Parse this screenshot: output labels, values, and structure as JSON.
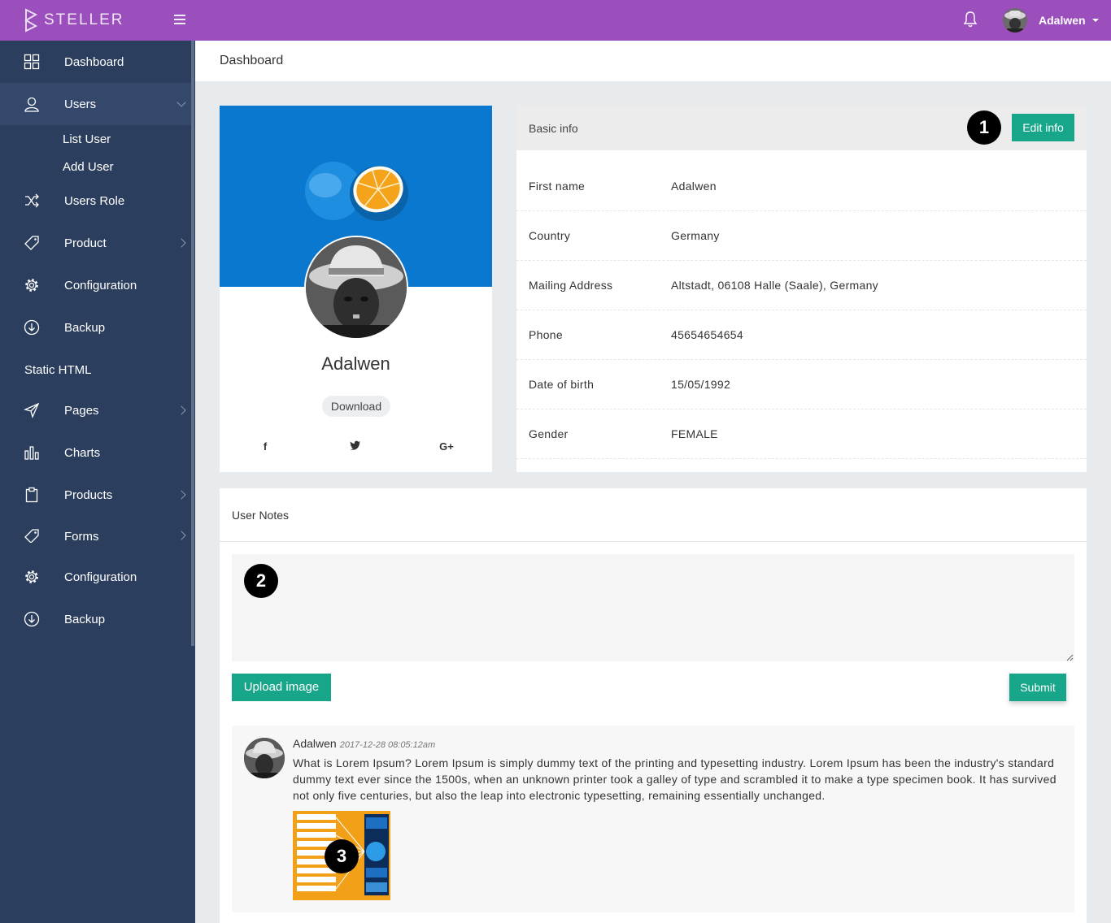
{
  "app": {
    "brand": "STELLER"
  },
  "topbar": {
    "username": "Adalwen"
  },
  "sidebar": {
    "items": [
      {
        "label": "Dashboard"
      },
      {
        "label": "Users"
      },
      {
        "label": "Users Role"
      },
      {
        "label": "Product"
      },
      {
        "label": "Configuration"
      },
      {
        "label": "Backup"
      },
      {
        "label": "Pages"
      },
      {
        "label": "Charts"
      },
      {
        "label": "Products"
      },
      {
        "label": "Forms"
      },
      {
        "label": "Configuration"
      },
      {
        "label": "Backup"
      }
    ],
    "users_sub": [
      "List User",
      "Add User"
    ],
    "section": "Static HTML"
  },
  "breadcrumb": "Dashboard",
  "profile": {
    "name": "Adalwen",
    "download_label": "Download",
    "social": [
      "f",
      "t",
      "G+"
    ]
  },
  "basic_info": {
    "title": "Basic info",
    "edit_label": "Edit info",
    "rows": [
      {
        "label": "First name",
        "value": "Adalwen"
      },
      {
        "label": "Country",
        "value": "Germany"
      },
      {
        "label": "Mailing Address",
        "value": "Altstadt, 06108 Halle (Saale), Germany"
      },
      {
        "label": "Phone",
        "value": "45654654654"
      },
      {
        "label": "Date of birth",
        "value": "15/05/1992"
      },
      {
        "label": "Gender",
        "value": "FEMALE"
      }
    ]
  },
  "notes": {
    "title": "User Notes",
    "textarea_value": "",
    "upload_label": "Upload image",
    "submit_label": "Submit",
    "comment": {
      "author": "Adalwen",
      "time": "2017-12-28 08:05:12am",
      "text": "What is Lorem Ipsum? Lorem Ipsum is simply dummy text of the printing and typesetting industry. Lorem Ipsum has been the industry's standard dummy text ever since the 1500s, when an unknown printer took a galley of type and scrambled it to make a type specimen book. It has survived not only five centuries, but also the leap into electronic typesetting, remaining essentially unchanged."
    }
  },
  "badges": [
    "1",
    "2",
    "3"
  ],
  "colors": {
    "topbar": "#9a4fbd",
    "sidebar": "#2c3e5d",
    "accent": "#17a689"
  },
  "icons": [
    "logo-icon",
    "menu-icon",
    "bell-icon",
    "dashboard-icon",
    "user-icon",
    "shuffle-icon",
    "tag-icon",
    "gear-icon",
    "download-circle-icon",
    "send-icon",
    "bar-chart-icon",
    "clipboard-icon",
    "facebook-icon",
    "twitter-icon",
    "google-plus-icon"
  ]
}
